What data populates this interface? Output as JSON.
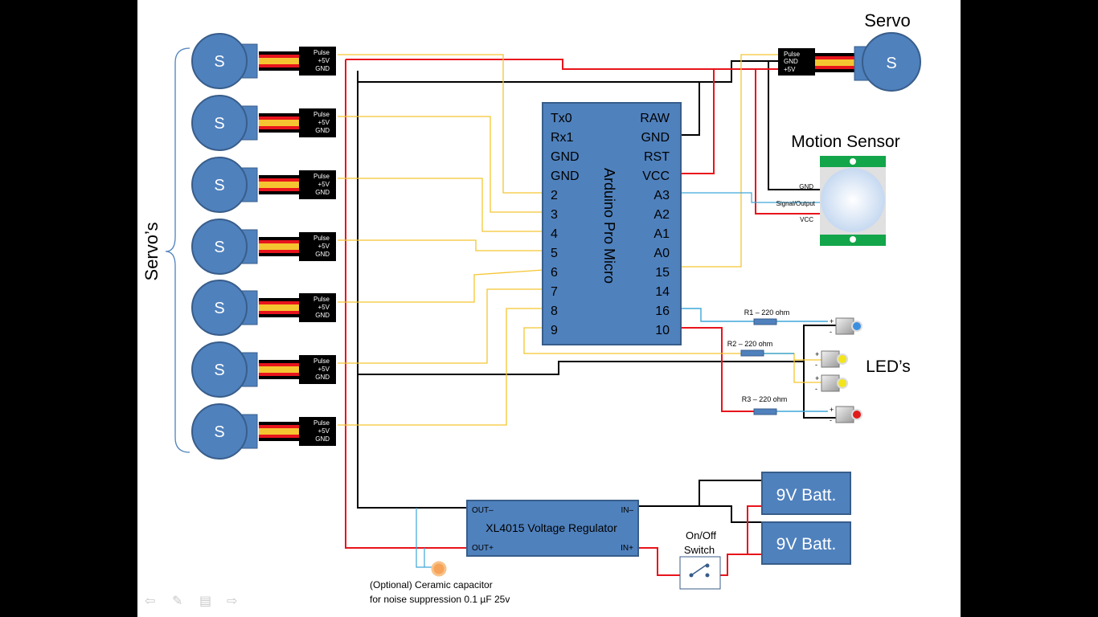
{
  "servo_letter": "S",
  "servo_connector": {
    "pulse": "Pulse",
    "v5": "+5V",
    "gnd": "GND"
  },
  "servos_label": "Servo’s",
  "servo_title": "Servo",
  "top_connector": {
    "pulse": "Pulse",
    "gnd": "GND",
    "v5": "+5V"
  },
  "arduino": {
    "name": "Arduino Pro Micro",
    "left_pins": [
      "Tx0",
      "Rx1",
      "GND",
      "GND",
      "2",
      "3",
      "4",
      "5",
      "6",
      "7",
      "8",
      "9"
    ],
    "right_pins": [
      "RAW",
      "GND",
      "RST",
      "VCC",
      "A3",
      "A2",
      "A1",
      "A0",
      "15",
      "14",
      "16",
      "10"
    ]
  },
  "motion_sensor": {
    "title": "Motion Sensor",
    "gnd": "GND",
    "signal": "Signal/Output",
    "vcc": "VCC"
  },
  "resistors": {
    "r1": "R1 – 220 ohm",
    "r2": "R2 – 220 ohm",
    "r3": "R3 – 220 ohm"
  },
  "leds_label": "LED’s",
  "led_marks": {
    "plus": "+",
    "minus": "-"
  },
  "regulator": {
    "name": "XL4015 Voltage Regulator",
    "out_minus": "OUT–",
    "out_plus": "OUT+",
    "in_minus": "IN–",
    "in_plus": "IN+"
  },
  "battery_label": "9V Batt.",
  "switch_label": [
    "On/Off",
    "Switch"
  ],
  "capacitor_note": [
    "(Optional) Ceramic capacitor",
    "for noise suppression 0.1  µF 25v"
  ],
  "colors": {
    "wire_red": "#e8141c",
    "wire_black": "#000000",
    "wire_yellow": "#f5c531",
    "wire_blue": "#3ea7d8",
    "box_fill": "#4f81bd",
    "box_stroke": "#385d8a",
    "sensor_green": "#13a54a"
  }
}
